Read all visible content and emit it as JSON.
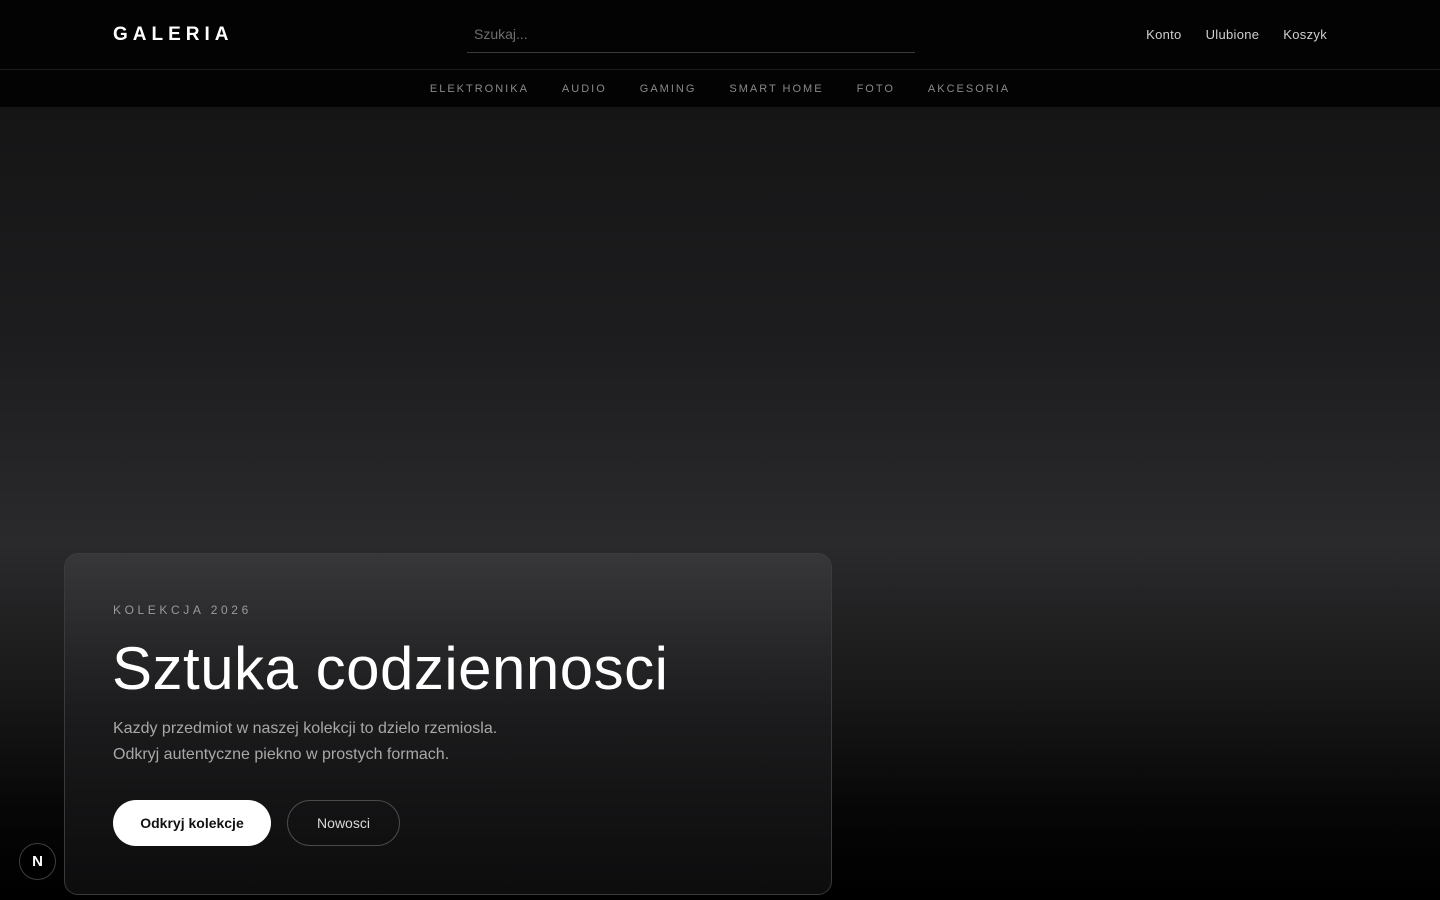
{
  "header": {
    "logo": "GALERIA",
    "search_placeholder": "Szukaj...",
    "account_nav": [
      "Konto",
      "Ulubione",
      "Koszyk"
    ]
  },
  "categories": [
    "ELEKTRONIKA",
    "AUDIO",
    "GAMING",
    "SMART HOME",
    "FOTO",
    "AKCESORIA"
  ],
  "hero": {
    "eyebrow": "KOLEKCJA 2026",
    "title": "Sztuka codziennosci",
    "desc_line1": "Kazdy przedmiot w naszej kolekcji to dzielo rzemiosla.",
    "desc_line2": "Odkryj autentyczne piekno w prostych formach.",
    "primary_cta": "Odkryj kolekcje",
    "secondary_cta": "Nowosci"
  },
  "badge": {
    "letter": "N"
  },
  "colors": {
    "background": "#000000",
    "primary_button_bg": "#ffffff",
    "text_muted": "#8a8a8a"
  }
}
